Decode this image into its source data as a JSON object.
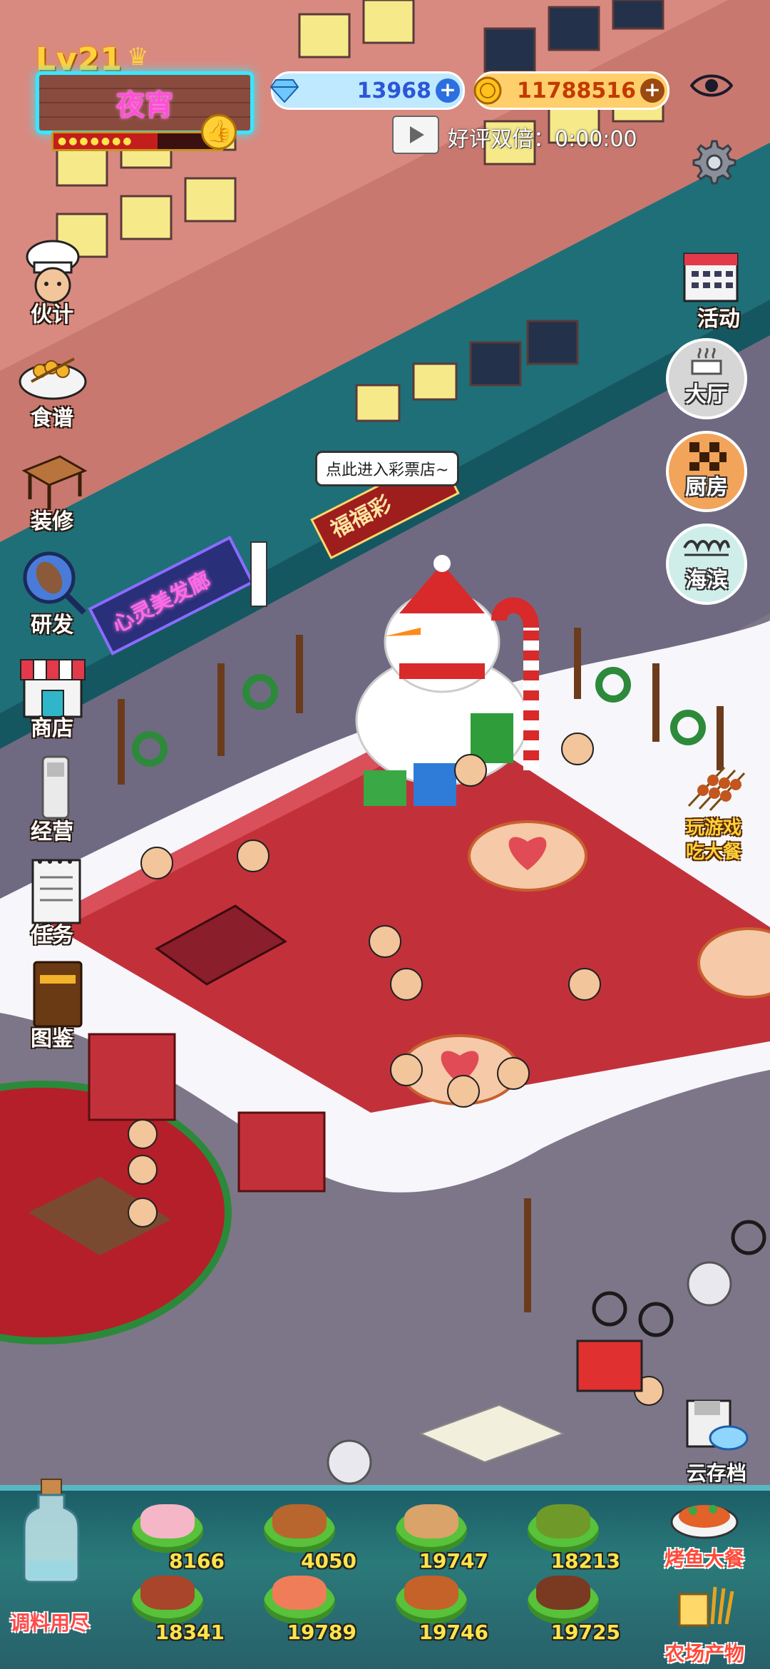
{
  "player": {
    "level": "Lv21",
    "shop_name": "夜宵"
  },
  "currency": {
    "gems": "13968",
    "coins": "11788516"
  },
  "bonus": {
    "text": "好评双倍：0:00:00"
  },
  "left_menu": [
    {
      "label": "伙计",
      "icon": "chef-icon"
    },
    {
      "label": "食谱",
      "icon": "recipe-icon"
    },
    {
      "label": "装修",
      "icon": "decorate-icon"
    },
    {
      "label": "研发",
      "icon": "research-icon"
    },
    {
      "label": "商店",
      "icon": "shop-icon"
    },
    {
      "label": "经营",
      "icon": "manage-icon"
    },
    {
      "label": "任务",
      "icon": "task-icon"
    },
    {
      "label": "图鉴",
      "icon": "handbook-icon"
    }
  ],
  "right_menu": [
    {
      "label": "活动",
      "icon": "calendar-icon"
    },
    {
      "label": "大厅",
      "icon": "hall-icon"
    },
    {
      "label": "厨房",
      "icon": "kitchen-icon"
    },
    {
      "label": "海滨",
      "icon": "seaside-icon"
    }
  ],
  "scene": {
    "speech_bubble": "点此进入彩票店~",
    "sign_barbershop": "心灵美发廊",
    "sign_lottery": "福福彩",
    "play_game_line1": "玩游戏",
    "play_game_line2": "吃大餐",
    "cloud_save": "云存档"
  },
  "ingredients": [
    {
      "count": "8166",
      "color": "#f5b6c8"
    },
    {
      "count": "4050",
      "color": "#b8662e"
    },
    {
      "count": "19747",
      "color": "#d9a36a"
    },
    {
      "count": "18213",
      "color": "#6f9a2a"
    },
    {
      "count": "18341",
      "color": "#a8452a"
    },
    {
      "count": "19789",
      "color": "#f07d5a"
    },
    {
      "count": "19746",
      "color": "#c4622a"
    },
    {
      "count": "19725",
      "color": "#7a3a22"
    }
  ],
  "seasoning": {
    "label": "调料用尽"
  },
  "dishes": [
    {
      "label": "烤鱼大餐"
    },
    {
      "label": "农场产物"
    }
  ],
  "colors": {
    "neon_cyan": "#39e6ff",
    "neon_pink": "#ff4fd8",
    "gold": "#ffd23c",
    "street": "#7d7688"
  }
}
